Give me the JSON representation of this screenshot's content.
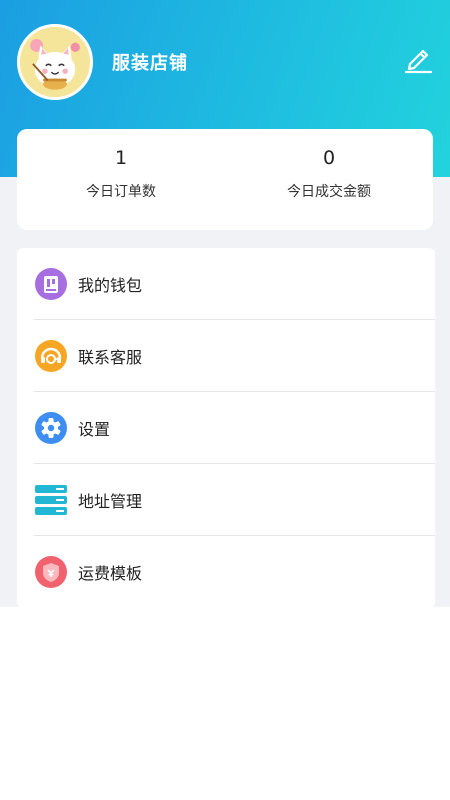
{
  "header": {
    "store_name": "服装店铺"
  },
  "stats": [
    {
      "value": "1",
      "label": "今日订单数"
    },
    {
      "value": "0",
      "label": "今日成交金额"
    }
  ],
  "menu": [
    {
      "label": "我的钱包",
      "icon": "wallet-icon",
      "color": "#a66ee0"
    },
    {
      "label": "联系客服",
      "icon": "customer-service-icon",
      "color": "#f6a623"
    },
    {
      "label": "设置",
      "icon": "settings-gear-icon",
      "color": "#3d8ef0"
    },
    {
      "label": "地址管理",
      "icon": "address-list-icon",
      "color": "#21b7d4"
    },
    {
      "label": "运费模板",
      "icon": "shipping-template-icon",
      "color": "#f0626d"
    }
  ],
  "colors": {
    "header_gradient_start": "#1b9ee2",
    "header_gradient_end": "#22d3dc",
    "page_background": "#f0f2f5"
  }
}
